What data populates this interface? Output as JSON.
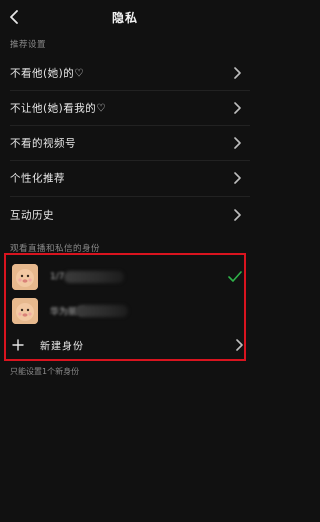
{
  "header": {
    "title": "隐私",
    "back_icon": "chevron-left-icon"
  },
  "sections": {
    "recommend_header": "推荐设置",
    "identity_header": "观看直播和私信的身份"
  },
  "settings": [
    {
      "label": "不看他(她)的♡"
    },
    {
      "label": "不让他(她)看我的♡"
    },
    {
      "label": "不看的视频号"
    },
    {
      "label": "个性化推荐"
    },
    {
      "label": "互动历史"
    }
  ],
  "identities": [
    {
      "name": "1/7",
      "selected": true,
      "avatar": "avatar-image"
    },
    {
      "name": "华为丽乐",
      "selected": false,
      "avatar": "avatar-image"
    }
  ],
  "new_identity": {
    "label": "新建身份"
  },
  "footnote": "只能设置1个新身份",
  "colors": {
    "background": "#111111",
    "highlight": "#d9141f",
    "check": "#2fb24a",
    "avatar": "#e7b98e"
  }
}
